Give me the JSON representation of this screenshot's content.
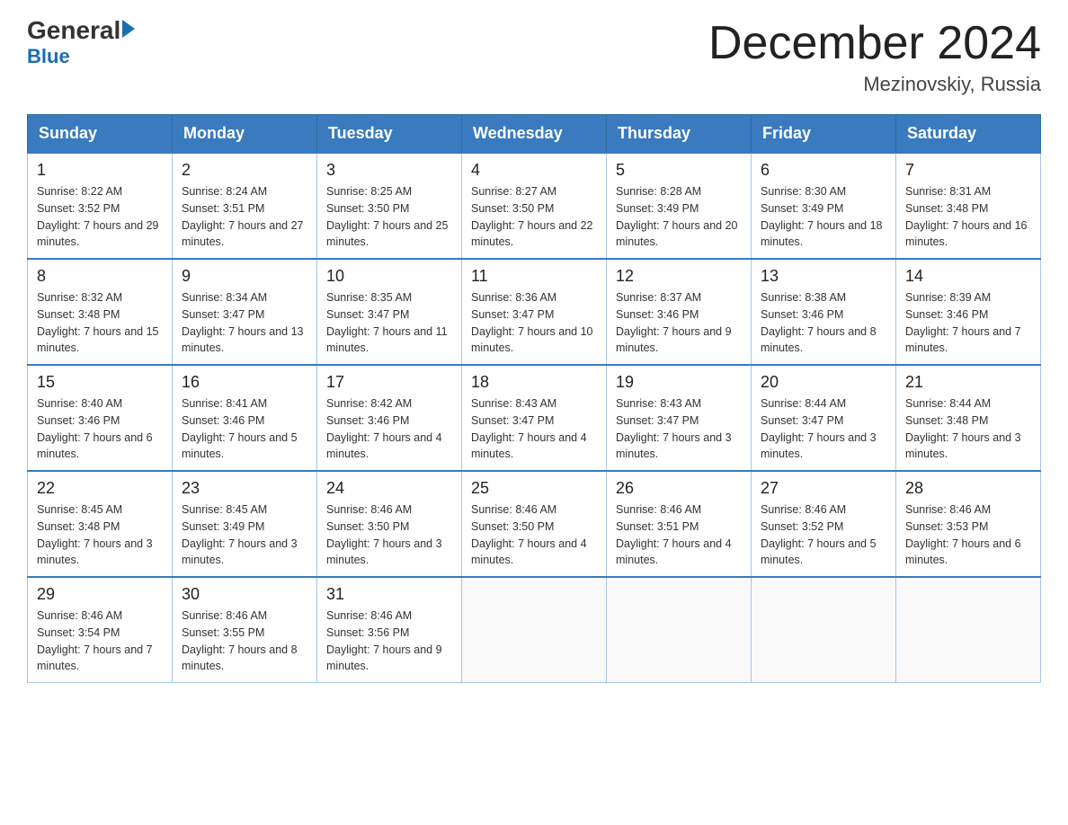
{
  "header": {
    "logo_general": "General",
    "logo_blue": "Blue",
    "month_title": "December 2024",
    "location": "Mezinovskiy, Russia"
  },
  "days_of_week": [
    "Sunday",
    "Monday",
    "Tuesday",
    "Wednesday",
    "Thursday",
    "Friday",
    "Saturday"
  ],
  "weeks": [
    [
      {
        "day": "1",
        "sunrise": "Sunrise: 8:22 AM",
        "sunset": "Sunset: 3:52 PM",
        "daylight": "Daylight: 7 hours and 29 minutes."
      },
      {
        "day": "2",
        "sunrise": "Sunrise: 8:24 AM",
        "sunset": "Sunset: 3:51 PM",
        "daylight": "Daylight: 7 hours and 27 minutes."
      },
      {
        "day": "3",
        "sunrise": "Sunrise: 8:25 AM",
        "sunset": "Sunset: 3:50 PM",
        "daylight": "Daylight: 7 hours and 25 minutes."
      },
      {
        "day": "4",
        "sunrise": "Sunrise: 8:27 AM",
        "sunset": "Sunset: 3:50 PM",
        "daylight": "Daylight: 7 hours and 22 minutes."
      },
      {
        "day": "5",
        "sunrise": "Sunrise: 8:28 AM",
        "sunset": "Sunset: 3:49 PM",
        "daylight": "Daylight: 7 hours and 20 minutes."
      },
      {
        "day": "6",
        "sunrise": "Sunrise: 8:30 AM",
        "sunset": "Sunset: 3:49 PM",
        "daylight": "Daylight: 7 hours and 18 minutes."
      },
      {
        "day": "7",
        "sunrise": "Sunrise: 8:31 AM",
        "sunset": "Sunset: 3:48 PM",
        "daylight": "Daylight: 7 hours and 16 minutes."
      }
    ],
    [
      {
        "day": "8",
        "sunrise": "Sunrise: 8:32 AM",
        "sunset": "Sunset: 3:48 PM",
        "daylight": "Daylight: 7 hours and 15 minutes."
      },
      {
        "day": "9",
        "sunrise": "Sunrise: 8:34 AM",
        "sunset": "Sunset: 3:47 PM",
        "daylight": "Daylight: 7 hours and 13 minutes."
      },
      {
        "day": "10",
        "sunrise": "Sunrise: 8:35 AM",
        "sunset": "Sunset: 3:47 PM",
        "daylight": "Daylight: 7 hours and 11 minutes."
      },
      {
        "day": "11",
        "sunrise": "Sunrise: 8:36 AM",
        "sunset": "Sunset: 3:47 PM",
        "daylight": "Daylight: 7 hours and 10 minutes."
      },
      {
        "day": "12",
        "sunrise": "Sunrise: 8:37 AM",
        "sunset": "Sunset: 3:46 PM",
        "daylight": "Daylight: 7 hours and 9 minutes."
      },
      {
        "day": "13",
        "sunrise": "Sunrise: 8:38 AM",
        "sunset": "Sunset: 3:46 PM",
        "daylight": "Daylight: 7 hours and 8 minutes."
      },
      {
        "day": "14",
        "sunrise": "Sunrise: 8:39 AM",
        "sunset": "Sunset: 3:46 PM",
        "daylight": "Daylight: 7 hours and 7 minutes."
      }
    ],
    [
      {
        "day": "15",
        "sunrise": "Sunrise: 8:40 AM",
        "sunset": "Sunset: 3:46 PM",
        "daylight": "Daylight: 7 hours and 6 minutes."
      },
      {
        "day": "16",
        "sunrise": "Sunrise: 8:41 AM",
        "sunset": "Sunset: 3:46 PM",
        "daylight": "Daylight: 7 hours and 5 minutes."
      },
      {
        "day": "17",
        "sunrise": "Sunrise: 8:42 AM",
        "sunset": "Sunset: 3:46 PM",
        "daylight": "Daylight: 7 hours and 4 minutes."
      },
      {
        "day": "18",
        "sunrise": "Sunrise: 8:43 AM",
        "sunset": "Sunset: 3:47 PM",
        "daylight": "Daylight: 7 hours and 4 minutes."
      },
      {
        "day": "19",
        "sunrise": "Sunrise: 8:43 AM",
        "sunset": "Sunset: 3:47 PM",
        "daylight": "Daylight: 7 hours and 3 minutes."
      },
      {
        "day": "20",
        "sunrise": "Sunrise: 8:44 AM",
        "sunset": "Sunset: 3:47 PM",
        "daylight": "Daylight: 7 hours and 3 minutes."
      },
      {
        "day": "21",
        "sunrise": "Sunrise: 8:44 AM",
        "sunset": "Sunset: 3:48 PM",
        "daylight": "Daylight: 7 hours and 3 minutes."
      }
    ],
    [
      {
        "day": "22",
        "sunrise": "Sunrise: 8:45 AM",
        "sunset": "Sunset: 3:48 PM",
        "daylight": "Daylight: 7 hours and 3 minutes."
      },
      {
        "day": "23",
        "sunrise": "Sunrise: 8:45 AM",
        "sunset": "Sunset: 3:49 PM",
        "daylight": "Daylight: 7 hours and 3 minutes."
      },
      {
        "day": "24",
        "sunrise": "Sunrise: 8:46 AM",
        "sunset": "Sunset: 3:50 PM",
        "daylight": "Daylight: 7 hours and 3 minutes."
      },
      {
        "day": "25",
        "sunrise": "Sunrise: 8:46 AM",
        "sunset": "Sunset: 3:50 PM",
        "daylight": "Daylight: 7 hours and 4 minutes."
      },
      {
        "day": "26",
        "sunrise": "Sunrise: 8:46 AM",
        "sunset": "Sunset: 3:51 PM",
        "daylight": "Daylight: 7 hours and 4 minutes."
      },
      {
        "day": "27",
        "sunrise": "Sunrise: 8:46 AM",
        "sunset": "Sunset: 3:52 PM",
        "daylight": "Daylight: 7 hours and 5 minutes."
      },
      {
        "day": "28",
        "sunrise": "Sunrise: 8:46 AM",
        "sunset": "Sunset: 3:53 PM",
        "daylight": "Daylight: 7 hours and 6 minutes."
      }
    ],
    [
      {
        "day": "29",
        "sunrise": "Sunrise: 8:46 AM",
        "sunset": "Sunset: 3:54 PM",
        "daylight": "Daylight: 7 hours and 7 minutes."
      },
      {
        "day": "30",
        "sunrise": "Sunrise: 8:46 AM",
        "sunset": "Sunset: 3:55 PM",
        "daylight": "Daylight: 7 hours and 8 minutes."
      },
      {
        "day": "31",
        "sunrise": "Sunrise: 8:46 AM",
        "sunset": "Sunset: 3:56 PM",
        "daylight": "Daylight: 7 hours and 9 minutes."
      },
      null,
      null,
      null,
      null
    ]
  ]
}
